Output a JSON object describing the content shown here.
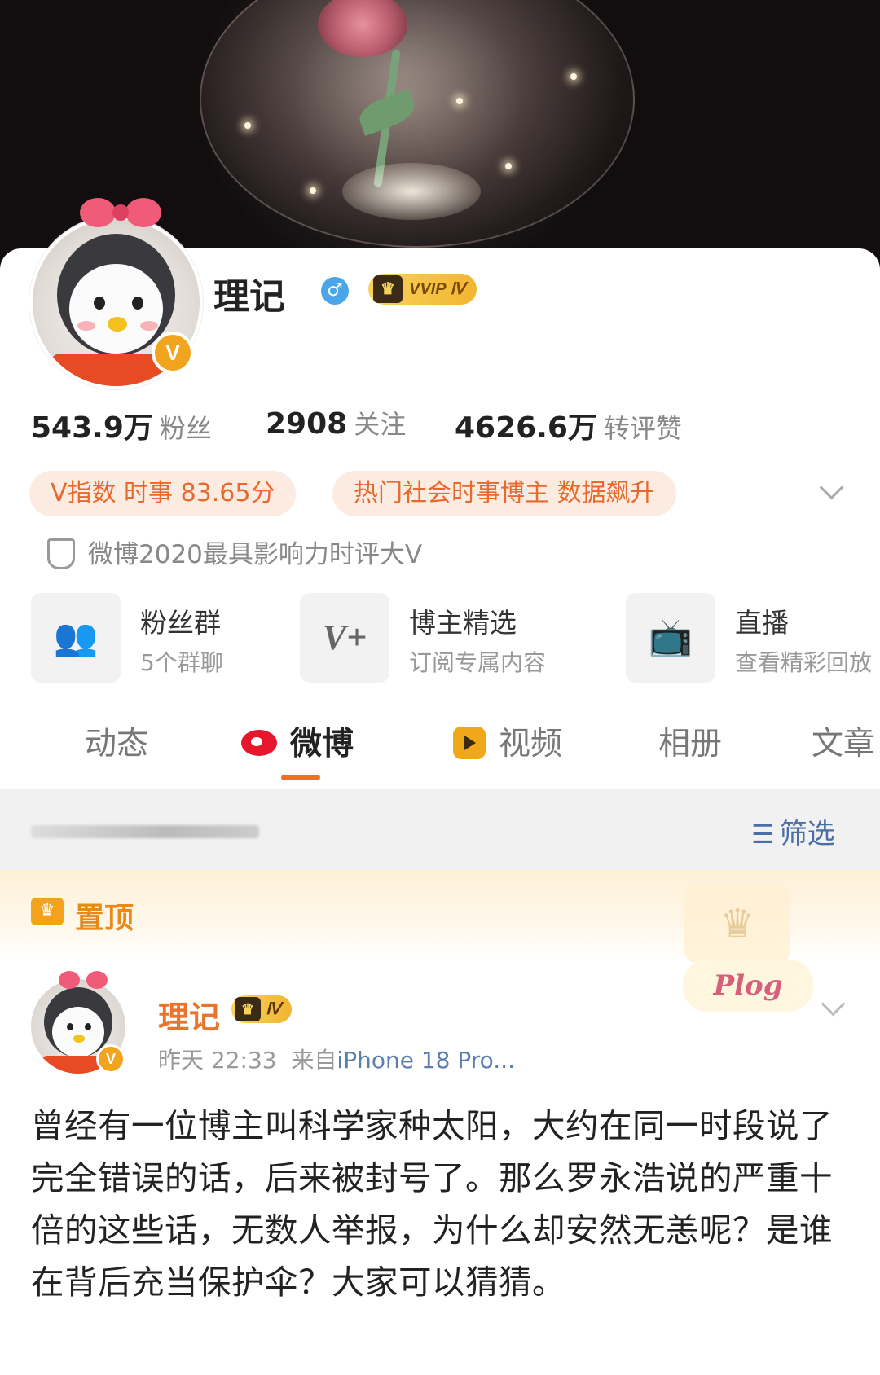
{
  "profile": {
    "name": "理记",
    "gender_symbol": "♂",
    "vip_badge": "VVIP Ⅳ",
    "verified_mark": "V",
    "stats": [
      {
        "value": "543.9万",
        "label": "粉丝"
      },
      {
        "value": "2908",
        "label": "关注"
      },
      {
        "value": "4626.6万",
        "label": "转评赞"
      }
    ],
    "tags": [
      "V指数 时事 83.65分",
      "热门社会时事博主 数据飙升"
    ],
    "honor": "微博2020最具影响力时评大V",
    "features": [
      {
        "title": "粉丝群",
        "subtitle": "5个群聊",
        "icon": "group-icon"
      },
      {
        "title": "博主精选",
        "subtitle": "订阅专属内容",
        "icon": "v-plus-icon"
      },
      {
        "title": "直播",
        "subtitle": "查看精彩回放",
        "icon": "tv-icon"
      }
    ]
  },
  "tabs": [
    "动态",
    "微博",
    "视频",
    "相册",
    "文章"
  ],
  "active_tab": "微博",
  "filter": {
    "label": "筛选"
  },
  "pinned": {
    "label": "置顶"
  },
  "post": {
    "author": "理记",
    "badge": "Ⅳ",
    "time": "昨天 22:33",
    "source_prefix": "来自",
    "source": "iPhone 18 Pro...",
    "sticker": "Plog",
    "text": "曾经有一位博主叫科学家种太阳，大约在同一时段说了完全错误的话，后来被封号了。那么罗永浩说的严重十倍的这些话，无数人举报，为什么却安然无恙呢？是谁在背后充当保护伞？大家可以猜猜。"
  },
  "colors": {
    "accent_orange": "#f56f1c",
    "tag_text": "#e8692d",
    "link_blue": "#4a6fa5",
    "vip_gold": "#f2b531"
  }
}
